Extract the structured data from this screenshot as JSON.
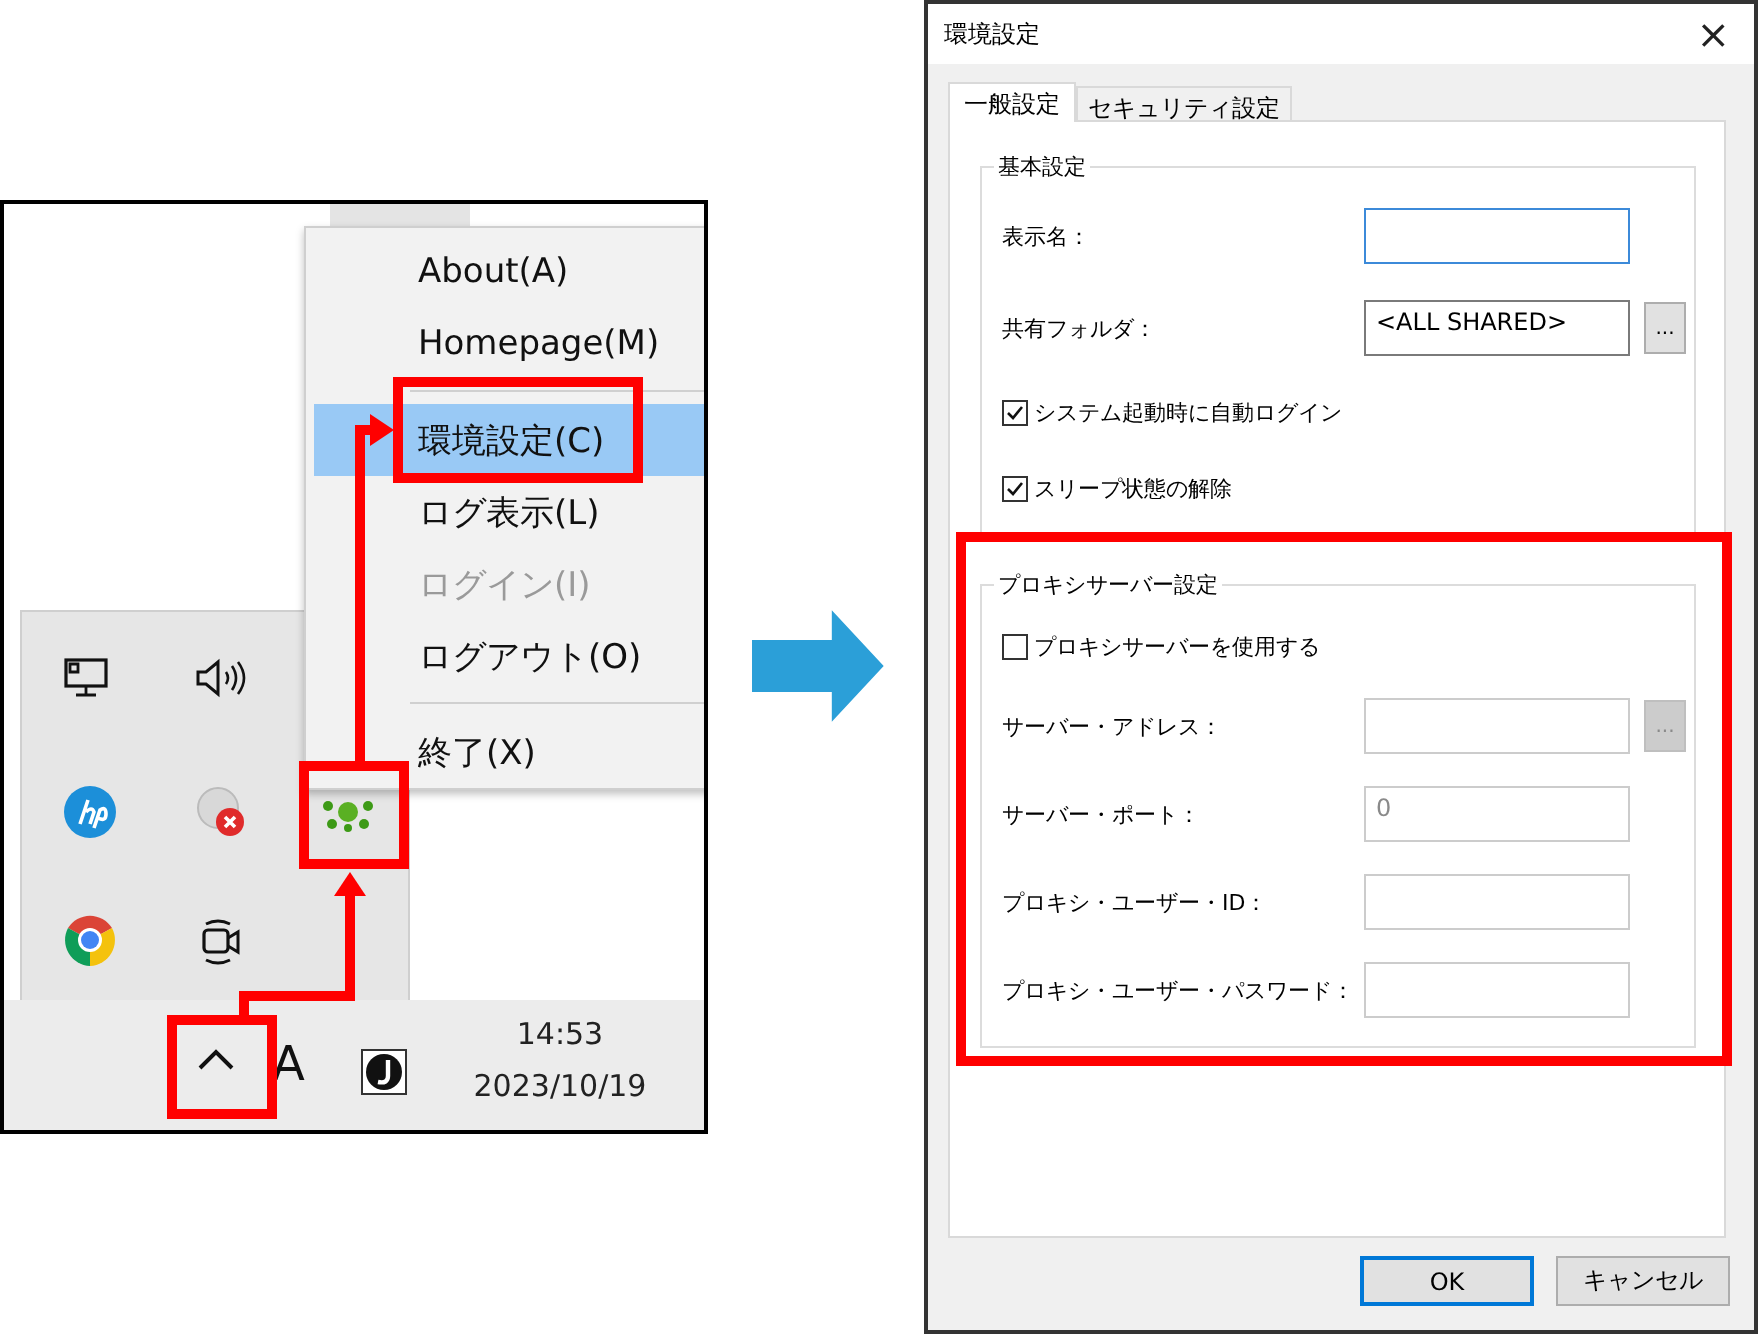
{
  "tray_screen": {
    "context_menu": [
      {
        "kind": "item",
        "label": "About(A)",
        "selected": false,
        "disabled": false
      },
      {
        "kind": "item",
        "label": "Homepage(M)",
        "selected": false,
        "disabled": false
      },
      {
        "kind": "separator"
      },
      {
        "kind": "item",
        "label": "環境設定(C)",
        "selected": true,
        "disabled": false
      },
      {
        "kind": "item",
        "label": "ログ表示(L)",
        "selected": false,
        "disabled": false
      },
      {
        "kind": "item",
        "label": "ログイン(I)",
        "selected": false,
        "disabled": true
      },
      {
        "kind": "item",
        "label": "ログアウト(O)",
        "selected": false,
        "disabled": false
      },
      {
        "kind": "separator"
      },
      {
        "kind": "item",
        "label": "終了(X)",
        "selected": false,
        "disabled": false
      }
    ],
    "taskbar": {
      "ime_indicator": "A",
      "time": "14:53",
      "date": "2023/10/19"
    }
  },
  "dialog": {
    "title": "環境設定",
    "close": "×",
    "tabs": [
      {
        "label": "一般設定",
        "selected": true
      },
      {
        "label": "セキュリティ設定",
        "selected": false
      }
    ],
    "groups": [
      {
        "title": "基本設定",
        "rows": [
          {
            "kind": "field",
            "label": "表示名：",
            "focused": true,
            "disabled": false
          },
          {
            "kind": "field",
            "label": "共有フォルダ：",
            "value": "<ALL SHARED>",
            "browse": "...",
            "focused": false,
            "disabled": false
          },
          {
            "kind": "checkbox",
            "label": "システム起動時に自動ログイン",
            "checked": true
          },
          {
            "kind": "checkbox",
            "label": "スリープ状態の解除",
            "checked": true
          }
        ]
      },
      {
        "title": "プロキシサーバー設定",
        "rows": [
          {
            "kind": "checkbox",
            "label": "プロキシサーバーを使用する",
            "checked": false
          },
          {
            "kind": "field",
            "label": "サーバー・アドレス：",
            "browse": "...",
            "focused": false,
            "disabled": true
          },
          {
            "kind": "field",
            "label": "サーバー・ポート：",
            "value": "0",
            "focused": false,
            "disabled": true
          },
          {
            "kind": "field",
            "label": "プロキシ・ユーザー・ID：",
            "focused": false,
            "disabled": true
          },
          {
            "kind": "field",
            "label": "プロキシ・ユーザー・パスワード：",
            "focused": false,
            "disabled": true
          }
        ]
      }
    ],
    "buttons": [
      {
        "label": "OK",
        "default": true
      },
      {
        "label": "キャンセル",
        "default": false
      }
    ]
  }
}
